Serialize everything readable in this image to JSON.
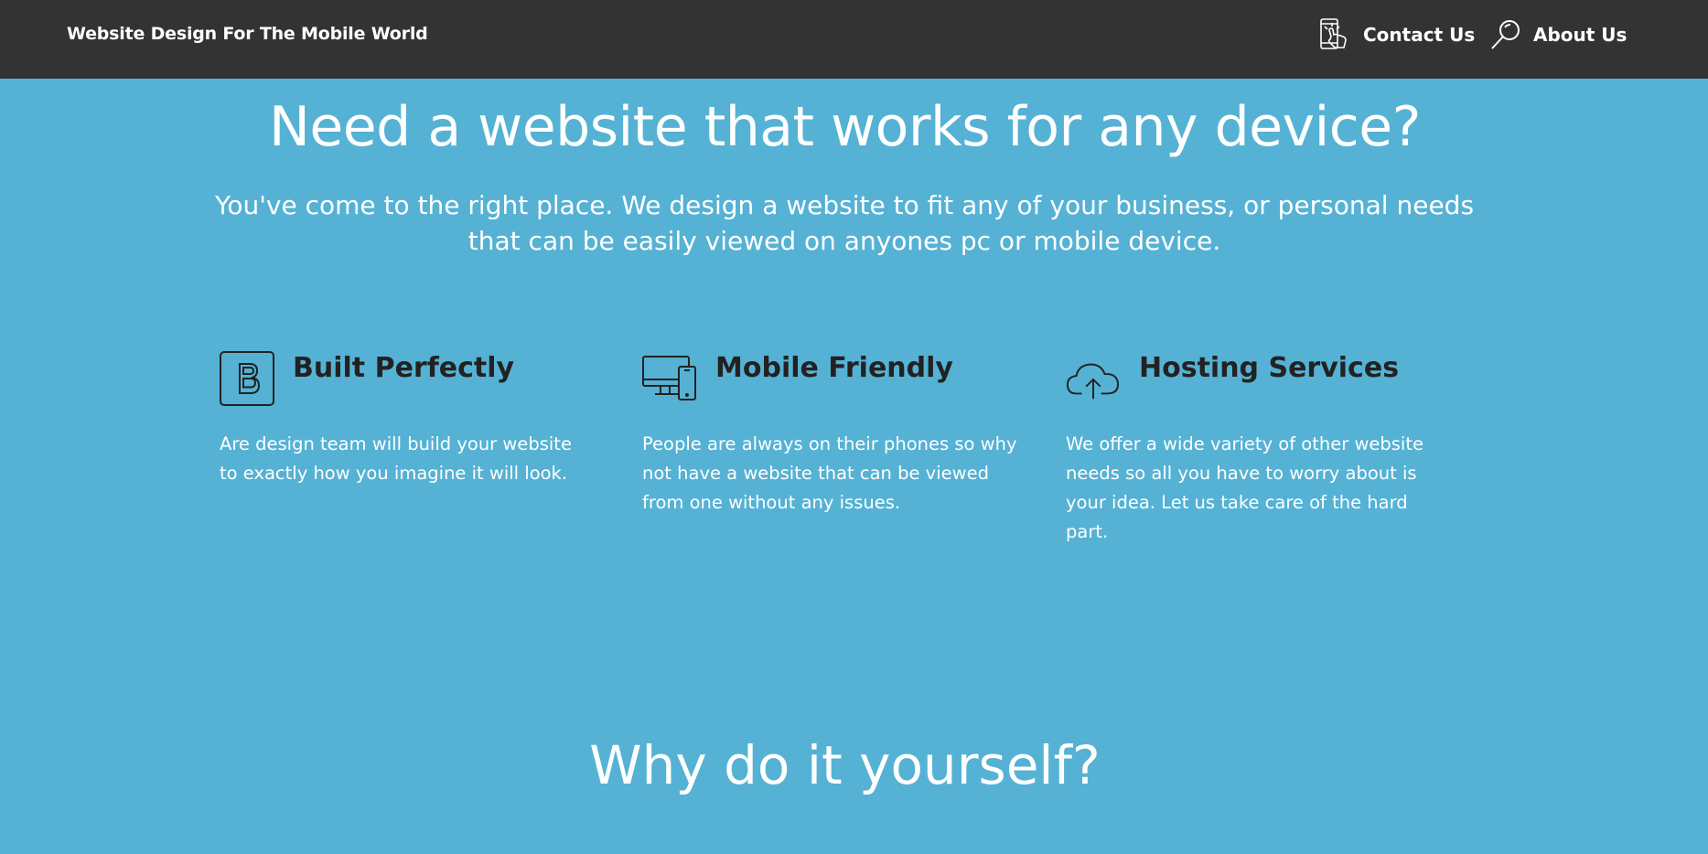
{
  "nav": {
    "brand": "Website Design For The Mobile World",
    "links": [
      {
        "label": "Contact Us",
        "icon": "phone-touch-icon"
      },
      {
        "label": "About Us",
        "icon": "magnifier-icon"
      }
    ]
  },
  "hero": {
    "title": "Need a website that works for any device?",
    "subtitle": "You've come to the right place.  We design a website to fit any of your business, or personal needs that can be easily viewed on anyones pc or mobile device."
  },
  "features": [
    {
      "icon": "bootstrap-b-icon",
      "title": "Built Perfectly",
      "text": "Are design team will build your website to exactly how you imagine it will look."
    },
    {
      "icon": "devices-icon",
      "title": "Mobile Friendly",
      "text": "People are always on their phones so why not have a website that can be viewed from one without any issues."
    },
    {
      "icon": "cloud-upload-icon",
      "title": "Hosting Services",
      "text": "We offer a wide variety of other website needs so all you have to worry about is your idea.  Let us take care of the hard part."
    }
  ],
  "section2": {
    "title": "Why do it yourself?"
  },
  "colors": {
    "background": "#55b2d4",
    "navbar": "#333333",
    "heading_dark": "#222222",
    "text_light": "#ffffff"
  }
}
